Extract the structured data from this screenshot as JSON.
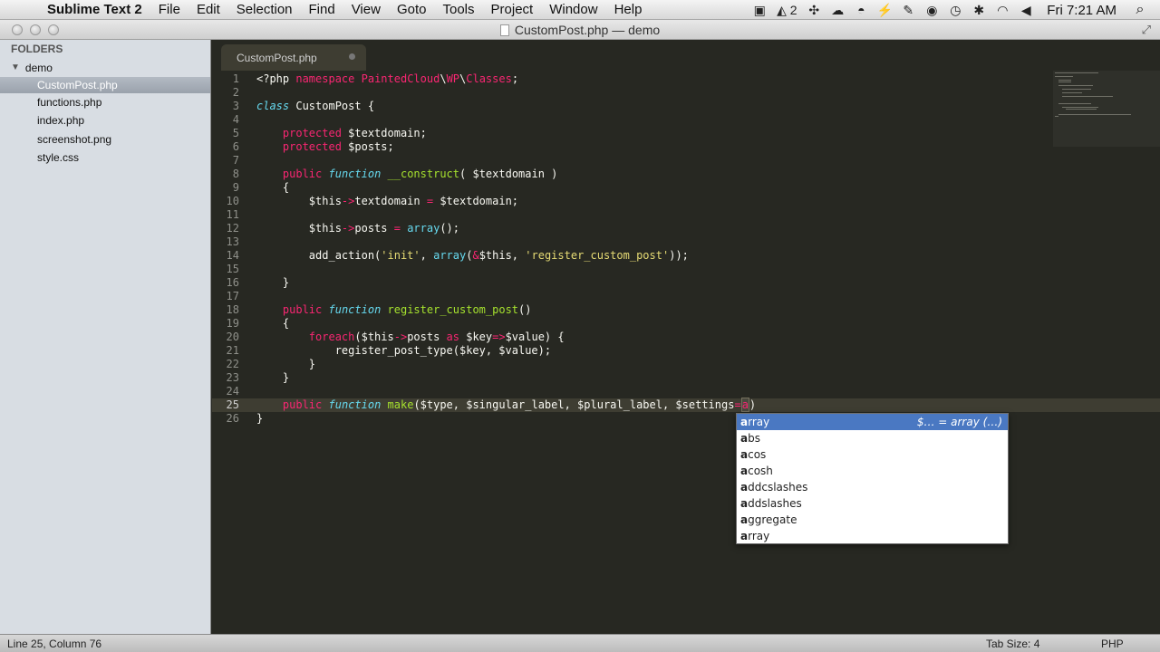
{
  "menubar": {
    "app_name": "Sublime Text 2",
    "items": [
      "File",
      "Edit",
      "Selection",
      "Find",
      "View",
      "Goto",
      "Tools",
      "Project",
      "Window",
      "Help"
    ],
    "adobe_badge": "2",
    "clock": "Fri 7:21 AM"
  },
  "window": {
    "title": "CustomPost.php — demo"
  },
  "sidebar": {
    "header": "FOLDERS",
    "folder": "demo",
    "files": [
      "CustomPost.php",
      "functions.php",
      "index.php",
      "screenshot.png",
      "style.css"
    ],
    "selected_file": "CustomPost.php"
  },
  "tab": {
    "label": "CustomPost.php"
  },
  "editor": {
    "line_numbers": [
      "1",
      "2",
      "3",
      "4",
      "5",
      "6",
      "7",
      "8",
      "9",
      "10",
      "11",
      "12",
      "13",
      "14",
      "15",
      "16",
      "17",
      "18",
      "19",
      "20",
      "21",
      "22",
      "23",
      "24",
      "25",
      "26"
    ],
    "current_line": 25
  },
  "autocomplete": {
    "items": [
      {
        "match": "a",
        "rest": "rray",
        "hint": "$… = array (…)"
      },
      {
        "match": "a",
        "rest": "bs",
        "hint": ""
      },
      {
        "match": "a",
        "rest": "cos",
        "hint": ""
      },
      {
        "match": "a",
        "rest": "cosh",
        "hint": ""
      },
      {
        "match": "a",
        "rest": "ddcslashes",
        "hint": ""
      },
      {
        "match": "a",
        "rest": "ddslashes",
        "hint": ""
      },
      {
        "match": "a",
        "rest": "ggregate",
        "hint": ""
      },
      {
        "match": "a",
        "rest": "rray",
        "hint": ""
      }
    ]
  },
  "statusbar": {
    "position": "Line 25, Column 76",
    "tab_size": "Tab Size: 4",
    "syntax": "PHP"
  },
  "colors": {
    "editor_bg": "#272822",
    "keyword": "#f92672",
    "storage": "#66d9ef",
    "function_name": "#a6e22e",
    "string": "#e6db74",
    "autocomplete_selected": "#4a78c2"
  }
}
